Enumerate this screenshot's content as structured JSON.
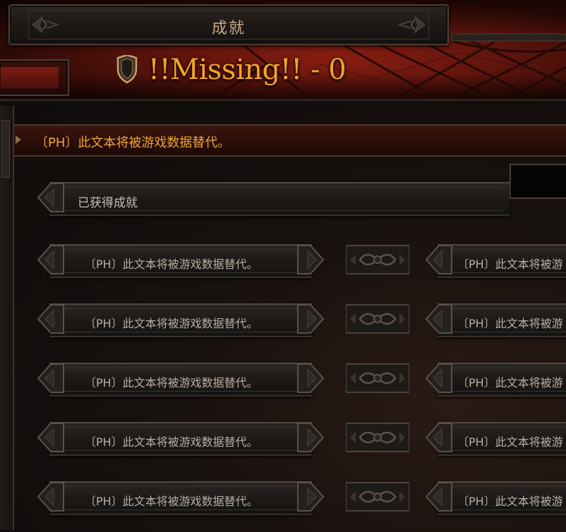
{
  "window": {
    "title": "成就"
  },
  "header": {
    "headline": "!!Missing!! - 0"
  },
  "banner": {
    "text": "〔PH〕此文本将被游戏数据替代。"
  },
  "section": {
    "title": "已获得成就"
  },
  "achievements": {
    "left": [
      "〔PH〕此文本将被游戏数据替代。",
      "〔PH〕此文本将被游戏数据替代。",
      "〔PH〕此文本将被游戏数据替代。",
      "〔PH〕此文本将被游戏数据替代。",
      "〔PH〕此文本将被游戏数据替代。"
    ],
    "right": [
      "〔PH〕此文本将被游",
      "〔PH〕此文本将被游",
      "〔PH〕此文本将被游",
      "〔PH〕此文本将被游",
      "〔PH〕此文本将被游"
    ]
  },
  "colors": {
    "headline": "#f2a423",
    "banner_text": "#e9a43a",
    "row_text": "#b9aea4"
  }
}
